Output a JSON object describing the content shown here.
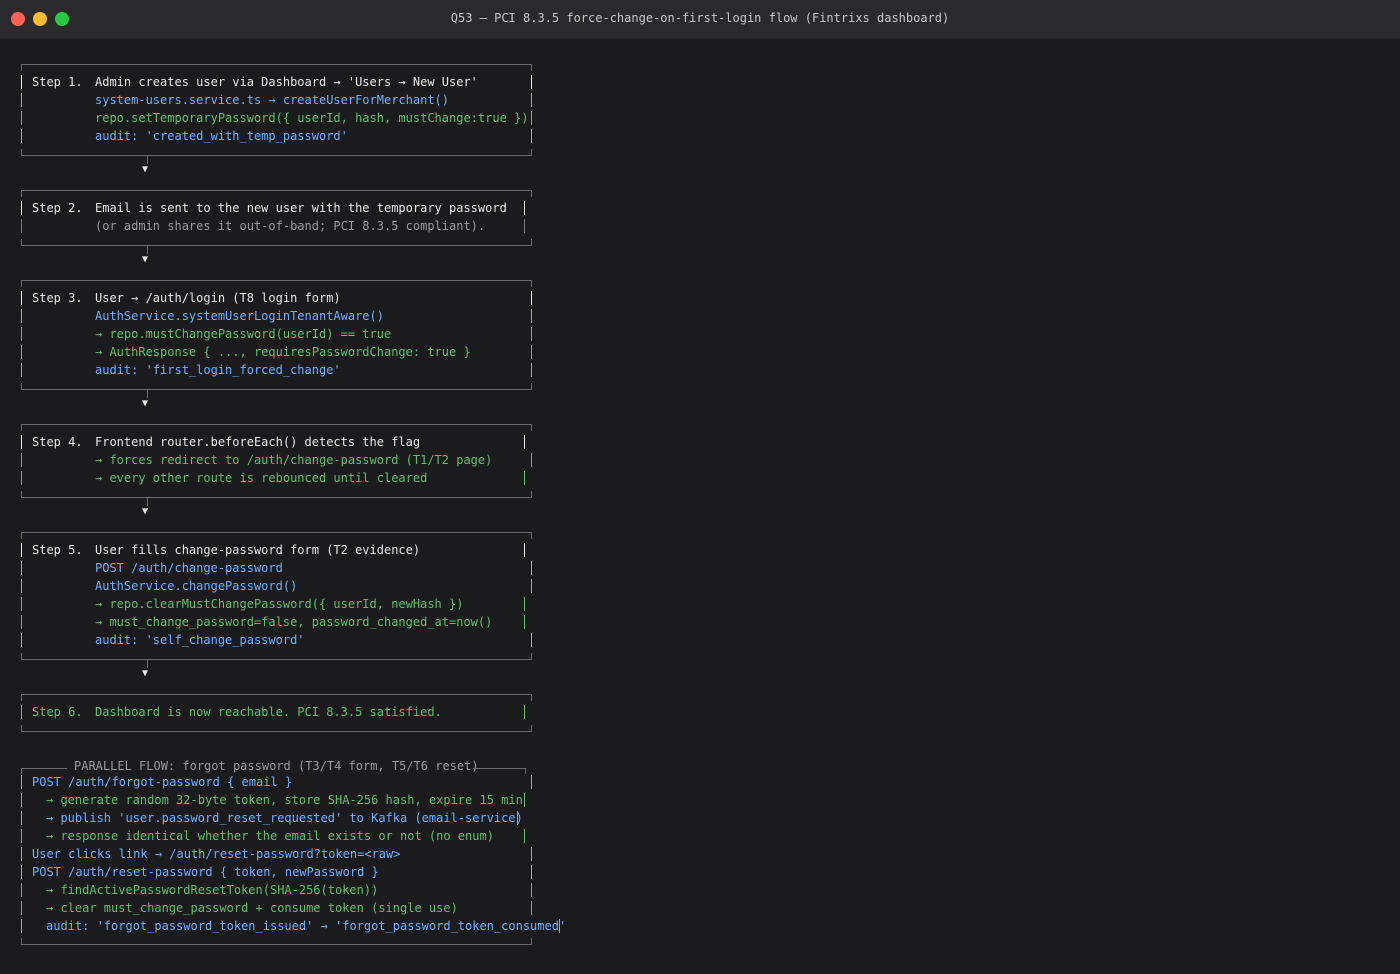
{
  "window": {
    "title": "Q53 — PCI 8.3.5 force-change-on-first-login flow (Fintrixs dashboard)"
  },
  "steps": [
    {
      "label": "Step 1.",
      "lines": [
        {
          "text": "Admin creates user via Dashboard → 'Users → New User'",
          "color": "white"
        },
        {
          "text": "system-users.service.ts → createUserForMerchant()",
          "color": "blue"
        },
        {
          "text": "repo.setTemporaryPassword({ userId, hash, mustChange:true })",
          "color": "green"
        },
        {
          "text": "audit: 'created_with_temp_password'",
          "color": "blue"
        }
      ]
    },
    {
      "label": "Step 2.",
      "lines": [
        {
          "text": "Email is sent to the new user with the temporary password",
          "color": "white"
        },
        {
          "text": "(or admin shares it out-of-band; PCI 8.3.5 compliant).",
          "color": "gray"
        }
      ]
    },
    {
      "label": "Step 3.",
      "lines": [
        {
          "text": "User → /auth/login (T8 login form)",
          "color": "white"
        },
        {
          "text": "AuthService.systemUserLoginTenantAware()",
          "color": "blue"
        },
        {
          "text": "→ repo.mustChangePassword(userId) == true",
          "color": "green"
        },
        {
          "text": "→ AuthResponse { ..., requiresPasswordChange: true }",
          "color": "green"
        },
        {
          "text": "audit: 'first_login_forced_change'",
          "color": "blue"
        }
      ]
    },
    {
      "label": "Step 4.",
      "lines": [
        {
          "text": "Frontend router.beforeEach() detects the flag",
          "color": "white"
        },
        {
          "text": "→ forces redirect to /auth/change-password (T1/T2 page)",
          "color": "green"
        },
        {
          "text": "→ every other route is rebounced until cleared",
          "color": "green"
        }
      ]
    },
    {
      "label": "Step 5.",
      "lines": [
        {
          "text": "User fills change-password form (T2 evidence)",
          "color": "white"
        },
        {
          "text": "POST /auth/change-password",
          "color": "blue"
        },
        {
          "text": "AuthService.changePassword()",
          "color": "blue"
        },
        {
          "text": "→ repo.clearMustChangePassword({ userId, newHash })",
          "color": "green"
        },
        {
          "text": "→ must_change_password=false, password_changed_at=now()",
          "color": "green"
        },
        {
          "text": "audit: 'self_change_password'",
          "color": "blue"
        }
      ]
    },
    {
      "label": "Step 6.",
      "label_color": "green",
      "lines": [
        {
          "text": "Dashboard is now reachable. PCI 8.3.5 satisfied.",
          "color": "green"
        }
      ]
    }
  ],
  "arrow_glyph": "▼",
  "parallel": {
    "title": "PARALLEL FLOW: forgot password (T3/T4 form, T5/T6 reset)",
    "lines": [
      {
        "text": "POST /auth/forgot-password { email }",
        "color": "blue",
        "indent": 0
      },
      {
        "text": "→ generate random 32-byte token, store SHA-256 hash, expire 15 min",
        "color": "green",
        "indent": 1
      },
      {
        "text": "→ publish 'user.password_reset_requested' to Kafka (email-service)",
        "color": "blue",
        "indent": 1
      },
      {
        "text": "→ response identical whether the email exists or not (no enum)",
        "color": "green",
        "indent": 1
      },
      {
        "text": "User clicks link → /auth/reset-password?token=<raw>",
        "color": "blue",
        "indent": 0
      },
      {
        "text": "POST /auth/reset-password { token, newPassword }",
        "color": "blue",
        "indent": 0
      },
      {
        "text": "→ findActivePasswordResetToken(SHA-256(token))",
        "color": "green",
        "indent": 1
      },
      {
        "text": "→ clear must_change_password + consume token (single use)",
        "color": "green",
        "indent": 1
      },
      {
        "text": "audit: 'forgot_password_token_issued' → 'forgot_password_token_consumed'",
        "color": "blue",
        "indent": 1
      }
    ]
  },
  "colors": {
    "white": "#e8e8e8",
    "blue": "#6db1ff",
    "green": "#5ec06a",
    "gray": "#9a9a9a",
    "border": "#6b6b6b",
    "background": "#1b1b1d"
  }
}
